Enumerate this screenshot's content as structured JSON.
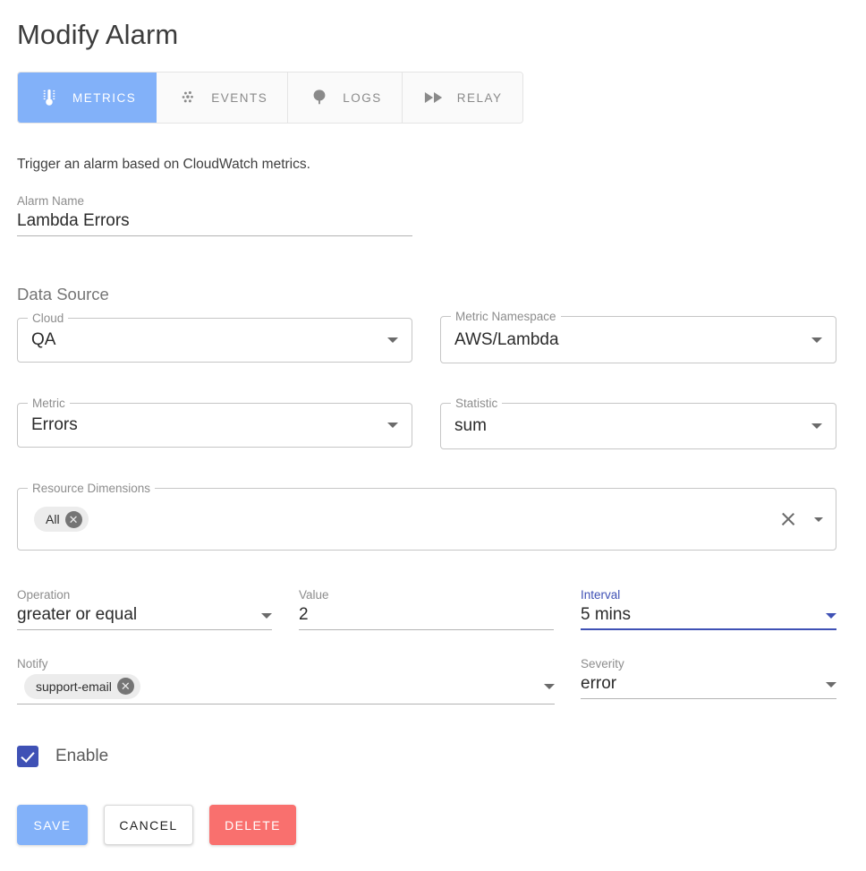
{
  "page": {
    "title": "Modify Alarm",
    "description": "Trigger an alarm based on CloudWatch metrics."
  },
  "tabs": [
    {
      "label": "METRICS",
      "icon": "thermometer-icon",
      "active": true
    },
    {
      "label": "EVENTS",
      "icon": "bubble-dots-icon",
      "active": false
    },
    {
      "label": "LOGS",
      "icon": "tree-icon",
      "active": false
    },
    {
      "label": "RELAY",
      "icon": "fast-forward-icon",
      "active": false
    }
  ],
  "alarm_name": {
    "label": "Alarm Name",
    "value": "Lambda Errors"
  },
  "data_source": {
    "heading": "Data Source",
    "cloud": {
      "label": "Cloud",
      "value": "QA"
    },
    "metric_namespace": {
      "label": "Metric Namespace",
      "value": "AWS/Lambda"
    },
    "metric": {
      "label": "Metric",
      "value": "Errors"
    },
    "statistic": {
      "label": "Statistic",
      "value": "sum"
    },
    "resource_dimensions": {
      "label": "Resource Dimensions",
      "chips": [
        "All"
      ]
    }
  },
  "condition": {
    "operation": {
      "label": "Operation",
      "value": "greater or equal"
    },
    "value": {
      "label": "Value",
      "value": "2"
    },
    "interval": {
      "label": "Interval",
      "value": "5 mins",
      "focused": true
    }
  },
  "notification": {
    "notify": {
      "label": "Notify",
      "chips": [
        "support-email"
      ]
    },
    "severity": {
      "label": "Severity",
      "value": "error"
    }
  },
  "enable": {
    "label": "Enable",
    "checked": true
  },
  "buttons": {
    "save": "SAVE",
    "cancel": "CANCEL",
    "delete": "DELETE"
  },
  "colors": {
    "accent_blue": "#82b1f9",
    "focus_indigo": "#3f51b5",
    "delete_red": "#f9706e",
    "chip_bg": "#ececec",
    "border_grey": "#c6c6c6"
  }
}
